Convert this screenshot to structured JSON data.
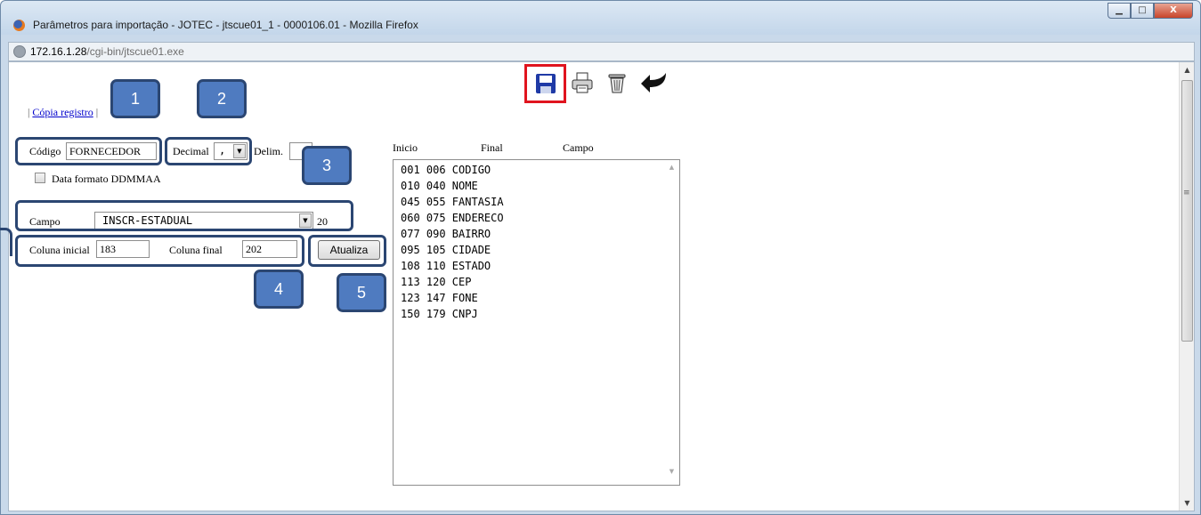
{
  "window": {
    "title": "Parâmetros para importação - JOTEC - jtscue01_1 - 0000106.01 - Mozilla Firefox",
    "minimize_symbol": "▁",
    "maximize_symbol": "□",
    "close_symbol": "X"
  },
  "address": {
    "host": "172.16.1.28",
    "path": "/cgi-bin/jtscue01.exe"
  },
  "toolbar": {
    "icons": [
      "save-icon",
      "printer-icon",
      "trash-icon",
      "back-arrow-icon"
    ]
  },
  "links": {
    "prefix": "| ",
    "copy_record": "Cópia registro",
    "suffix": " |"
  },
  "form": {
    "codigo_label": "Código",
    "codigo_value": "FORNECEDOR",
    "decimal_label": "Decimal",
    "decimal_value": ",",
    "delim_label": "Delim.",
    "delim_value": "",
    "date_format_label": "Data formato DDMMAA",
    "campo_label": "Campo",
    "campo_value": "INSCR-ESTADUAL",
    "campo_size": "20",
    "col_ini_label": "Coluna inicial",
    "col_ini_value": "183",
    "col_fin_label": "Coluna final",
    "col_fin_value": "202",
    "update_button": "Atualiza"
  },
  "list": {
    "headers": [
      "Inicio",
      "Final",
      "Campo"
    ],
    "items": [
      "001 006 CODIGO",
      "010 040 NOME",
      "045 055 FANTASIA",
      "060 075 ENDERECO",
      "077 090 BAIRRO",
      "095 105 CIDADE",
      "108 110 ESTADO",
      "113 120 CEP",
      "123 147 FONE",
      "150 179 CNPJ"
    ]
  },
  "callouts": [
    "1",
    "2",
    "3",
    "4",
    "5"
  ],
  "colors": {
    "callout_fill": "#4f7bc0",
    "callout_border": "#2b4672",
    "save_highlight": "#e0141e"
  }
}
